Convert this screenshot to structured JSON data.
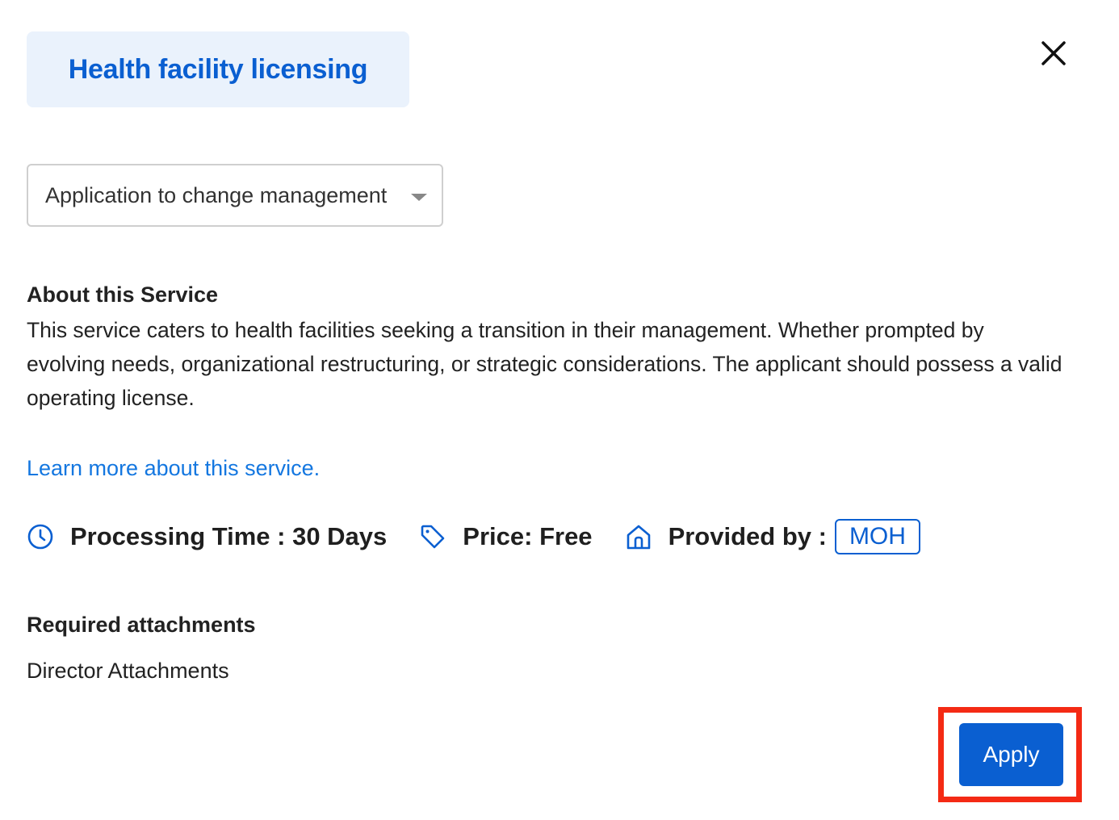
{
  "header": {
    "title": "Health facility licensing",
    "close_icon": "close-icon"
  },
  "service_select": {
    "selected_value": "Application to change management",
    "icon": "chevron-down-icon"
  },
  "about": {
    "heading": "About this Service",
    "description": "This service caters to health facilities seeking a transition in their management. Whether prompted by evolving needs, organizational restructuring, or strategic considerations. The applicant should possess a valid operating license."
  },
  "learn_more_link": "Learn more about this service.",
  "meta": {
    "processing_time": "Processing Time : 30 Days",
    "processing_icon": "clock-icon",
    "price": "Price: Free",
    "price_icon": "tag-icon",
    "provided_by_label": "Provided by :",
    "provider_icon": "home-icon",
    "provider": "MOH"
  },
  "attachments": {
    "heading": "Required attachments",
    "items": [
      "Director Attachments"
    ]
  },
  "actions": {
    "apply_label": "Apply"
  },
  "colors": {
    "primary": "#0a5fd1",
    "link": "#1477e0",
    "title_chip_bg": "#eaf2fc",
    "highlight": "#f42a14"
  }
}
